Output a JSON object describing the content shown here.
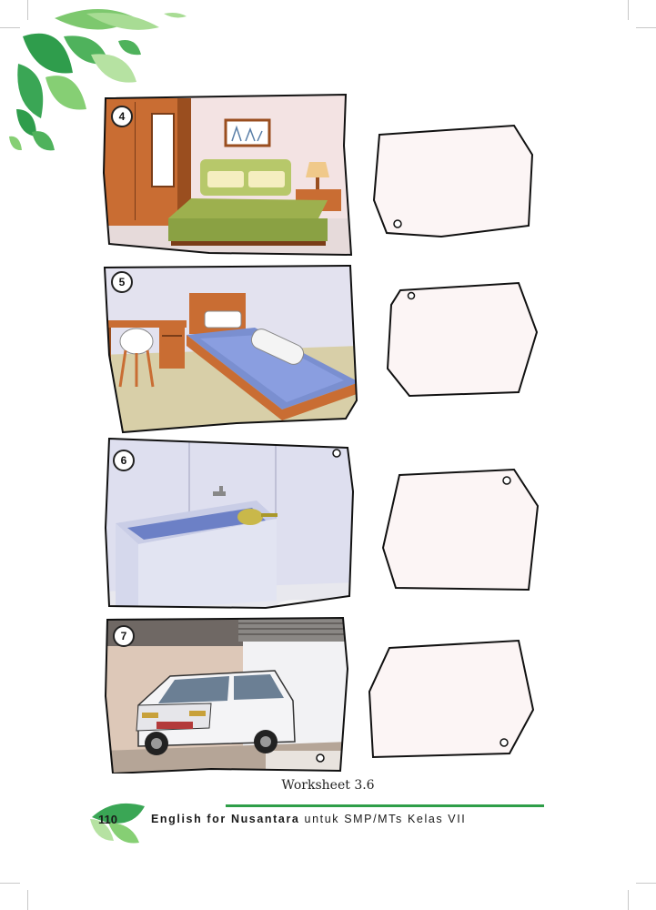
{
  "scenes": [
    {
      "number": "4",
      "room": "bedroom with wardrobe and double bed"
    },
    {
      "number": "5",
      "room": "bedroom with desk and single bed"
    },
    {
      "number": "6",
      "room": "bathroom"
    },
    {
      "number": "7",
      "room": "garage"
    }
  ],
  "caption": "Worksheet 3.6",
  "footer": {
    "page_number": "110",
    "book_title_bold": "English for Nusantara",
    "book_title_rest": " untuk SMP/MTs Kelas VII"
  },
  "colors": {
    "leaf_green": "#3aa655",
    "footer_green": "#2e9e48"
  }
}
